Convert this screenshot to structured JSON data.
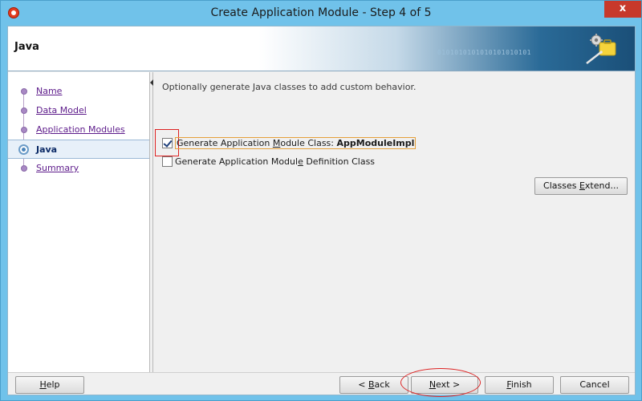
{
  "window": {
    "title": "Create Application Module - Step 4 of 5",
    "close_glyph": "x"
  },
  "banner": {
    "title": "Java",
    "binary_text": "0101010101010101010101"
  },
  "nav": {
    "items": [
      {
        "label": "Name",
        "state": "visited"
      },
      {
        "label": "Data Model",
        "state": "visited"
      },
      {
        "label": "Application Modules",
        "state": "visited"
      },
      {
        "label": "Java",
        "state": "active"
      },
      {
        "label": "Summary",
        "state": "visited"
      }
    ]
  },
  "content": {
    "hint": "Optionally generate Java classes to add custom behavior.",
    "checkbox_app_module": {
      "label_prefix": "Generate Application ",
      "mnemonic": "M",
      "label_middle": "odule Class: ",
      "class_name": "AppModuleImpl",
      "checked": true
    },
    "checkbox_definition": {
      "label_prefix": "Generate Application Modul",
      "mnemonic": "e",
      "label_suffix": " Definition Class",
      "checked": false
    },
    "classes_extend": {
      "prefix": "Classes ",
      "mnemonic": "E",
      "suffix": "xtend..."
    }
  },
  "buttons": {
    "help": {
      "mnemonic": "H",
      "rest": "elp"
    },
    "back": {
      "prefix": "< ",
      "mnemonic": "B",
      "rest": "ack"
    },
    "next": {
      "mnemonic": "N",
      "rest": "ext >"
    },
    "finish": {
      "mnemonic": "F",
      "rest": "inish"
    },
    "cancel": {
      "label": "Cancel"
    }
  },
  "colors": {
    "frame": "#70c2ea",
    "close_button": "#c7392b",
    "nav_link": "#5c1a8a",
    "annotation": "#dd2222"
  }
}
